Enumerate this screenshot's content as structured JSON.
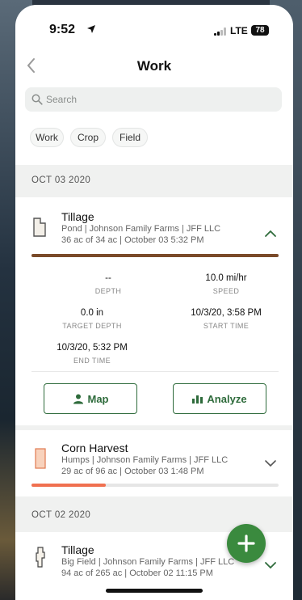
{
  "status_bar": {
    "time": "9:52",
    "network": "LTE",
    "battery": "78"
  },
  "header": {
    "title": "Work"
  },
  "search": {
    "placeholder": "Search"
  },
  "filters": [
    "Work",
    "Crop",
    "Field"
  ],
  "sections": [
    {
      "date": "OCT 03 2020",
      "items": [
        {
          "title": "Tillage",
          "line1": "Pond | Johnson Family Farms | JFF LLC",
          "line2": "36 ac of 34 ac | October 03 5:32 PM",
          "expanded": true,
          "progress": 1.0,
          "color": "#7a4a2a",
          "details": [
            {
              "value": "--",
              "label": "DEPTH"
            },
            {
              "value": "10.0 mi/hr",
              "label": "SPEED"
            },
            {
              "value": "0.0 in",
              "label": "TARGET DEPTH"
            },
            {
              "value": "10/3/20, 3:58 PM",
              "label": "START TIME"
            },
            {
              "value": "10/3/20, 5:32 PM",
              "label": "END TIME"
            }
          ],
          "actions": {
            "map": "Map",
            "analyze": "Analyze"
          }
        },
        {
          "title": "Corn Harvest",
          "line1": "Humps | Johnson Family Farms | JFF LLC",
          "line2": "29 ac of 96 ac | October 03 1:48 PM",
          "expanded": false,
          "progress": 0.3,
          "color": "#f07050"
        }
      ]
    },
    {
      "date": "OCT 02 2020",
      "items": [
        {
          "title": "Tillage",
          "line1": "Big Field | Johnson Family Farms | JFF LLC",
          "line2": "94 ac of 265 ac | October 02 11:15 PM",
          "expanded": false
        }
      ]
    }
  ],
  "colors": {
    "accent": "#2e6b3b",
    "fab": "#3a8a3e"
  }
}
